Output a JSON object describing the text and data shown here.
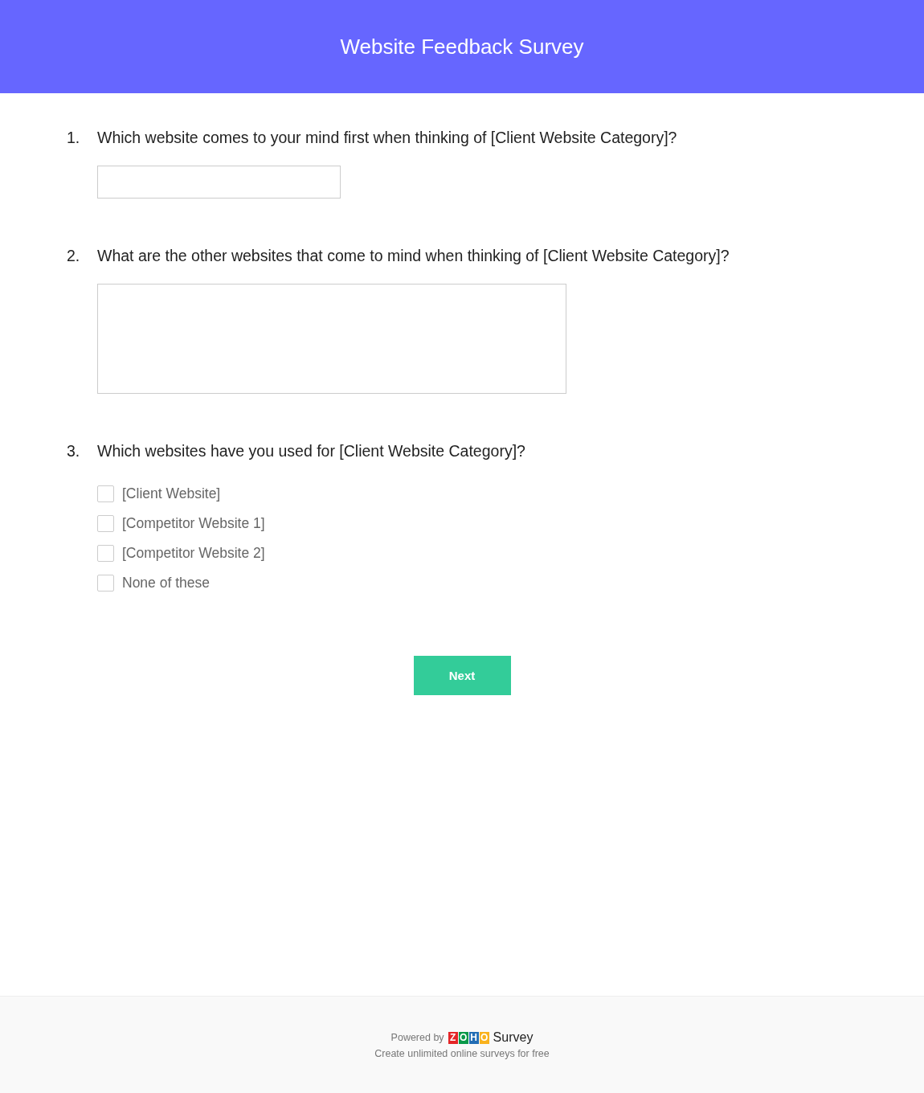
{
  "header": {
    "title": "Website Feedback Survey"
  },
  "questions": [
    {
      "number": "1.",
      "text": "Which website comes to your mind first when thinking of [Client Website Category]?",
      "kind": "text"
    },
    {
      "number": "2.",
      "text": "What are the other websites that come to mind when thinking of [Client Website Category]?",
      "kind": "textarea"
    },
    {
      "number": "3.",
      "text": "Which websites have you used for [Client Website Category]?",
      "kind": "checkbox",
      "options": [
        {
          "label": "[Client Website]",
          "checked": false
        },
        {
          "label": "[Competitor Website 1]",
          "checked": false
        },
        {
          "label": "[Competitor Website 2]",
          "checked": false
        },
        {
          "label": "None of these",
          "checked": false
        }
      ]
    }
  ],
  "next_button": "Next",
  "footer": {
    "powered_by": "Powered by",
    "logo_letters": [
      {
        "letter": "Z",
        "color": "#e42527"
      },
      {
        "letter": "O",
        "color": "#089949"
      },
      {
        "letter": "H",
        "color": "#226db4"
      },
      {
        "letter": "O",
        "color": "#f9b21d"
      }
    ],
    "product": "Survey",
    "tagline": "Create unlimited online surveys for free"
  }
}
